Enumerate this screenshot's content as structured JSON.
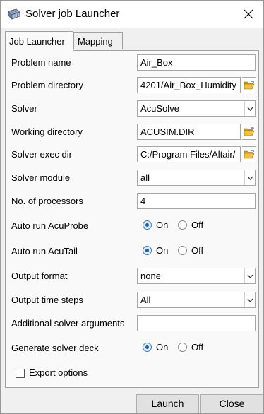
{
  "window": {
    "title": "Solver job Launcher",
    "icon": "grid-app-icon",
    "close_icon": "close-icon"
  },
  "tabs": [
    {
      "label": "Job Launcher",
      "active": true
    },
    {
      "label": "Mapping",
      "active": false
    }
  ],
  "form": {
    "problem_name": {
      "label": "Problem name",
      "value": "Air_Box"
    },
    "problem_directory": {
      "label": "Problem directory",
      "value": "4201/Air_Box_Humidity"
    },
    "solver": {
      "label": "Solver",
      "value": "AcuSolve"
    },
    "working_directory": {
      "label": "Working directory",
      "value": "ACUSIM.DIR"
    },
    "solver_exec_dir": {
      "label": "Solver exec dir",
      "value": "C:/Program Files/Altair/"
    },
    "solver_module": {
      "label": "Solver module",
      "value": "all"
    },
    "num_processors": {
      "label": "No. of processors",
      "value": "4"
    },
    "auto_run_acuprobe": {
      "label": "Auto run AcuProbe",
      "on_label": "On",
      "off_label": "Off",
      "selected": "On"
    },
    "auto_run_acutail": {
      "label": "Auto run AcuTail",
      "on_label": "On",
      "off_label": "Off",
      "selected": "On"
    },
    "output_format": {
      "label": "Output format",
      "value": "none"
    },
    "output_time_steps": {
      "label": "Output time steps",
      "value": "All"
    },
    "additional_args": {
      "label": "Additional solver arguments",
      "value": ""
    },
    "generate_solver_deck": {
      "label": "Generate solver deck",
      "on_label": "On",
      "off_label": "Off",
      "selected": "On"
    },
    "export_options": {
      "label": "Export options",
      "checked": false
    }
  },
  "buttons": {
    "launch": "Launch",
    "close": "Close"
  }
}
